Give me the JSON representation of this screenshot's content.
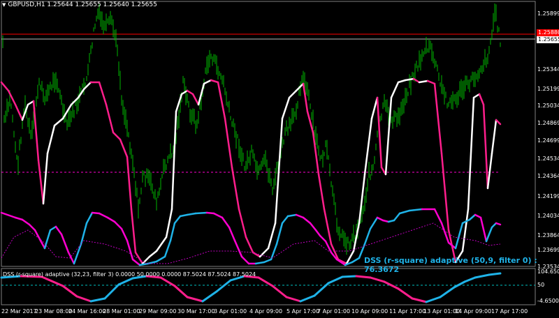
{
  "header": {
    "symbol_line": "GBPUSD,H1  1.25644 1.25655 1.25640 1.25655",
    "triangle": "▼"
  },
  "price_axis": {
    "ticks": [
      "1.25899",
      "1.25655",
      "1.25344",
      "1.25199",
      "1.25034",
      "1.24869",
      "1.24699",
      "1.24534",
      "1.24364",
      "1.24199",
      "1.24034",
      "1.23864",
      "1.23699",
      "1.23534"
    ],
    "current_price": "1.25655",
    "alert_price": "1.25880"
  },
  "time_axis": {
    "ticks": [
      "22 Mar 2017",
      "23 Mar 08:00",
      "24 Mar 16:00",
      "28 Mar 01:00",
      "29 Mar 09:00",
      "30 Mar 17:00",
      "3 Apr 01:00",
      "4 Apr 09:00",
      "5 Apr 17:00",
      "7 Apr 01:00",
      "10 Apr 09:00",
      "11 Apr 17:00",
      "13 Apr 01:00",
      "14 Apr 09:00",
      "17 Apr 17:00"
    ]
  },
  "overlay": {
    "label": "DSS (r-square) adaptive (50,9, filter 0) : 76.3672"
  },
  "indicator": {
    "title": "DSS (r-square) adaptive (32,23, filter 3) 0.0000 50.0000 0.0000 87.5024 87.5024 87.5024",
    "ticks": [
      "104.6500",
      "50",
      "-4.6500"
    ],
    "right_label": "-4.6500"
  },
  "colors": {
    "background": "#000000",
    "candles": "#00b400",
    "dss_up": "#ffffff",
    "dss_down": "#ff1e8c",
    "lower_up": "#1fb3e8",
    "lower_down": "#ff00d0",
    "level_red": "#ff0000",
    "dotted": "#c000c0",
    "teal": "#00c0c0"
  }
}
